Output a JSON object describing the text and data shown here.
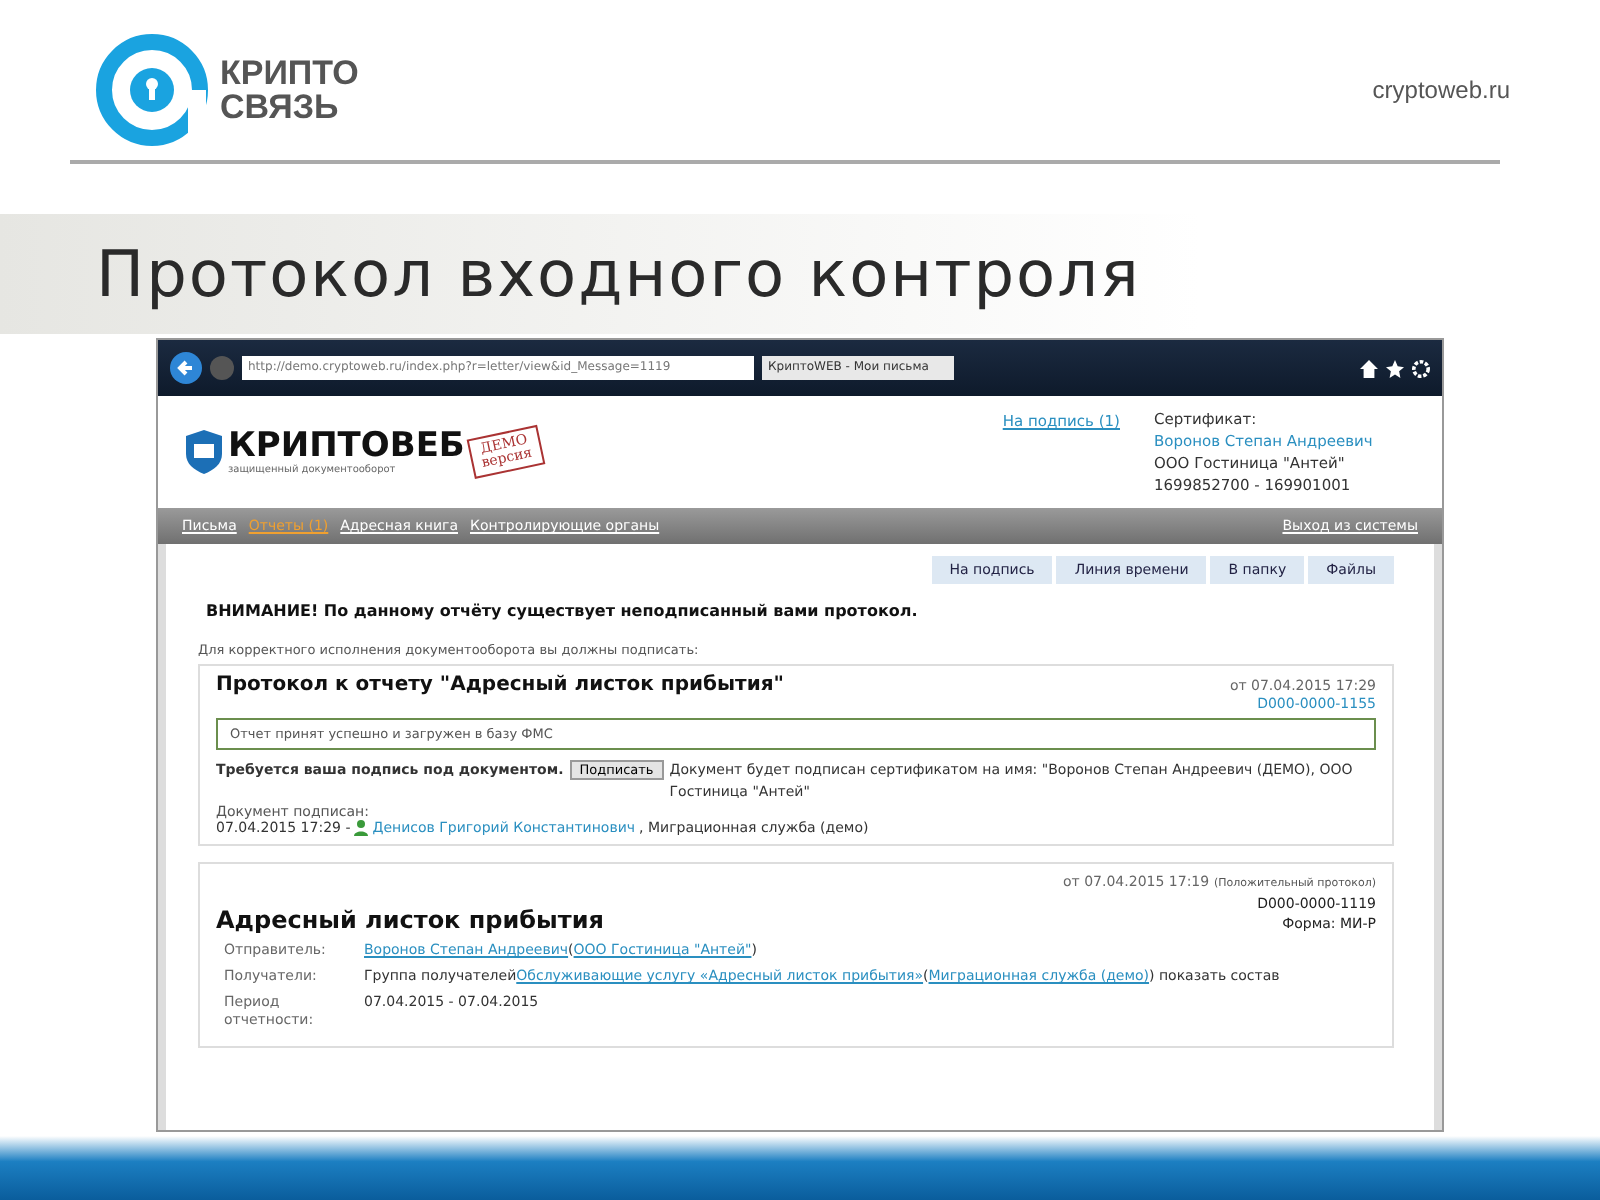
{
  "slide": {
    "brand_line_1": "КРИПТО",
    "brand_line_2": "СВЯЗЬ",
    "site": "cryptoweb.ru",
    "title": "Протокол входного контроля"
  },
  "browser": {
    "url": "http://demo.cryptoweb.ru/index.php?r=letter/view&id_Message=1119",
    "tab": "КриптоWEB - Мои письма"
  },
  "app": {
    "logo": "КРИПТОВЕБ",
    "logo_sub": "защищенный документооборот",
    "stamp_1": "ДЕМО",
    "stamp_2": "версия",
    "to_sign": "На подпись (1)",
    "cert_label": "Сертификат:",
    "cert_name": "Воронов Степан Андреевич",
    "cert_org": "ООО Гостиница \"Антей\"",
    "cert_code": "1699852700 - 169901001",
    "nav": [
      {
        "label": "Письма",
        "selected": false
      },
      {
        "label": "Отчеты (1)",
        "selected": true
      },
      {
        "label": "Адресная книга",
        "selected": false
      },
      {
        "label": "Контролирующие органы",
        "selected": false
      }
    ],
    "logout": "Выход из системы",
    "actions": [
      "На подпись",
      "Линия времени",
      "В папку",
      "Файлы"
    ],
    "warning": "ВНИМАНИЕ! По данному отчёту существует неподписанный вами протокол.",
    "hint": "Для корректного исполнения документооборота вы должны подписать:",
    "protocol": {
      "title": "Протокол к отчету \"Адресный листок прибытия\"",
      "date": "от 07.04.2015 17:29",
      "number": "D000-0000-1155",
      "status": "Отчет принят успешно и загружен в базу ФМС",
      "sign_prompt": "Требуется ваша подпись под документом.",
      "sign_button": "Подписать",
      "sign_note": "Документ будет подписан сертификатом на имя: \"Воронов Степан Андреевич (ДЕМО), ООО Гостиница \"Антей\"",
      "signed_label": "Документ подписан:",
      "signed_date": "07.04.2015 17:29 -",
      "signer": "Денисов Григорий Константинович",
      "signer_org": ", Миграционная служба (демо)"
    },
    "report": {
      "date": "от 07.04.2015 17:19",
      "result": "(Положительный протокол)",
      "number": "D000-0000-1119",
      "form": "Форма: МИ-Р",
      "title": "Адресный листок прибытия",
      "rows": [
        {
          "label": "Отправитель:",
          "parts": [
            {
              "text": "Воронов Степан Андреевич",
              "link": true
            },
            {
              "text": "(",
              "link": false
            },
            {
              "text": "ООО Гостиница \"Антей\"",
              "link": true
            },
            {
              "text": ")",
              "link": false
            }
          ]
        },
        {
          "label": "Получатели:",
          "parts": [
            {
              "text": "Группа получателей",
              "link": false
            },
            {
              "text": "Обслуживающие услугу «Адресный листок прибытия»",
              "link": true
            },
            {
              "text": "(",
              "link": false
            },
            {
              "text": "Миграционная служба (демо)",
              "link": true
            },
            {
              "text": ") показать состав",
              "link": false
            }
          ]
        },
        {
          "label": "Период отчетности:",
          "parts": [
            {
              "text": "07.04.2015 - 07.04.2015",
              "link": false
            }
          ]
        }
      ]
    }
  }
}
